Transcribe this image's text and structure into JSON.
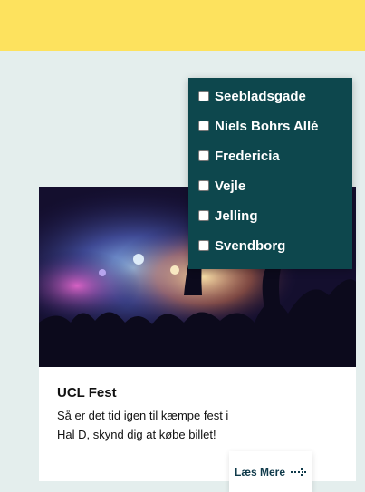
{
  "location_filter": {
    "options": [
      {
        "label": "Seebladsgade",
        "checked": false
      },
      {
        "label": "Niels Bohrs Allé",
        "checked": false
      },
      {
        "label": "Fredericia",
        "checked": false
      },
      {
        "label": "Vejle",
        "checked": false
      },
      {
        "label": "Jelling",
        "checked": false
      },
      {
        "label": "Svendborg",
        "checked": false
      }
    ]
  },
  "event_card": {
    "image": "concert-crowd-photo",
    "title": "UCL Fest",
    "text": "Så er det tid igen til kæmpe fest i Hal D, skynd dig at købe billet!",
    "read_more_label": "Læs Mere",
    "read_more_icon": "dotted-arrow-right-icon"
  },
  "colors": {
    "topbar": "#fde25e",
    "background": "#e4eeed",
    "dropdown": "#0d474d",
    "link": "#0f3a4a"
  }
}
